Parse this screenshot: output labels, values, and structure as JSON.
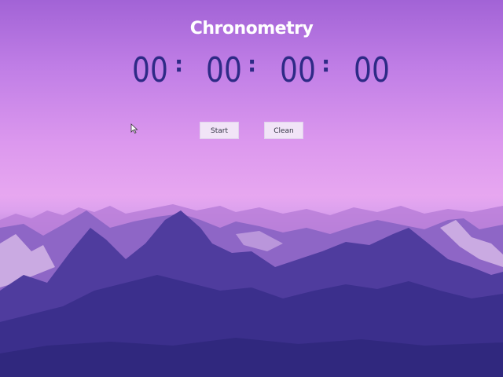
{
  "title": "Chronometry",
  "timer": {
    "hours": "00",
    "minutes": "00",
    "seconds": "00",
    "centiseconds": "00",
    "separator": ":"
  },
  "buttons": {
    "start_label": "Start",
    "clean_label": "Clean"
  },
  "colors": {
    "digits": "#2e2a86",
    "title": "#ffffff",
    "button_bg": "#f1e4f7"
  }
}
